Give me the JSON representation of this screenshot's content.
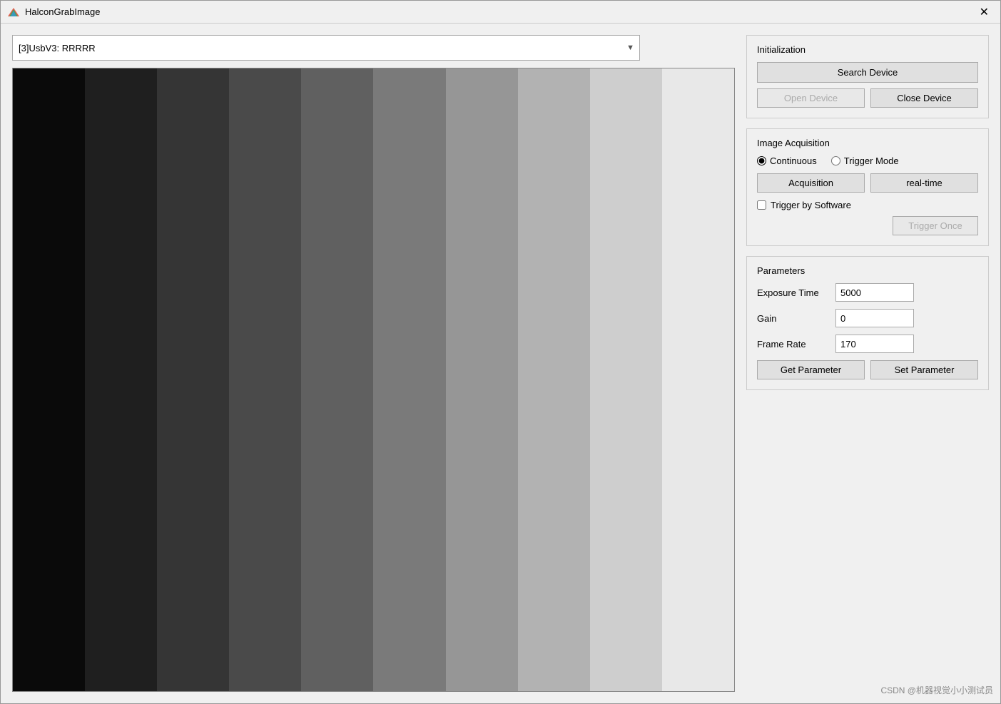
{
  "window": {
    "title": "HalconGrabImage",
    "close_label": "✕"
  },
  "device_dropdown": {
    "value": "[3]UsbV3:  RRRRR",
    "options": [
      "[3]UsbV3:  RRRRR"
    ]
  },
  "initialization": {
    "section_label": "Initialization",
    "search_device_label": "Search Device",
    "open_device_label": "Open Device",
    "close_device_label": "Close Device"
  },
  "image_acquisition": {
    "section_label": "Image Acquisition",
    "continuous_label": "Continuous",
    "trigger_mode_label": "Trigger Mode",
    "acquisition_label": "Acquisition",
    "realtime_label": "real-time",
    "trigger_software_label": "Trigger by Software",
    "trigger_once_label": "Trigger Once"
  },
  "parameters": {
    "section_label": "Parameters",
    "exposure_time_label": "Exposure Time",
    "exposure_time_value": "5000",
    "gain_label": "Gain",
    "gain_value": "0",
    "frame_rate_label": "Frame Rate",
    "frame_rate_value": "170",
    "get_parameter_label": "Get Parameter",
    "set_parameter_label": "Set Parameter"
  },
  "gradient_bars": [
    {
      "color": "#0a0a0a"
    },
    {
      "color": "#1f1f1f"
    },
    {
      "color": "#353535"
    },
    {
      "color": "#4a4a4a"
    },
    {
      "color": "#606060"
    },
    {
      "color": "#7a7a7a"
    },
    {
      "color": "#969696"
    },
    {
      "color": "#b2b2b2"
    },
    {
      "color": "#cecece"
    },
    {
      "color": "#e8e8e8"
    }
  ],
  "watermark": {
    "text": "CSDN @机器视觉小小测试员"
  }
}
